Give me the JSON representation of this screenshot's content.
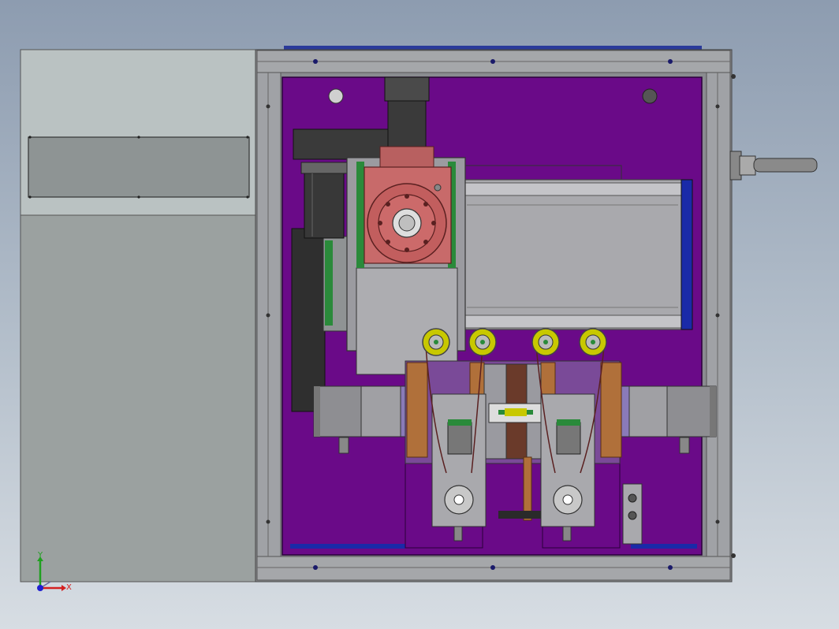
{
  "triad": {
    "y_label": "Y",
    "x_label": "X"
  },
  "colors": {
    "background_top": "#8d9cb0",
    "background_bottom": "#d7dde3",
    "cabinet_upper": "#b9c1c1",
    "cabinet_lower": "#9aa09f",
    "frame": "#7d7f84",
    "mount_plate": "#6a0e86",
    "motor_red": "#c06464",
    "motor_black": "#3a3a3a",
    "stage_gray": "#a8a8ab",
    "pulley_yellow": "#c8c800",
    "bracket_orange": "#b0703a",
    "rail_blue": "#1a2aa8",
    "triad_x": "#d42020",
    "triad_y": "#20a020",
    "triad_z": "#2020d0"
  }
}
